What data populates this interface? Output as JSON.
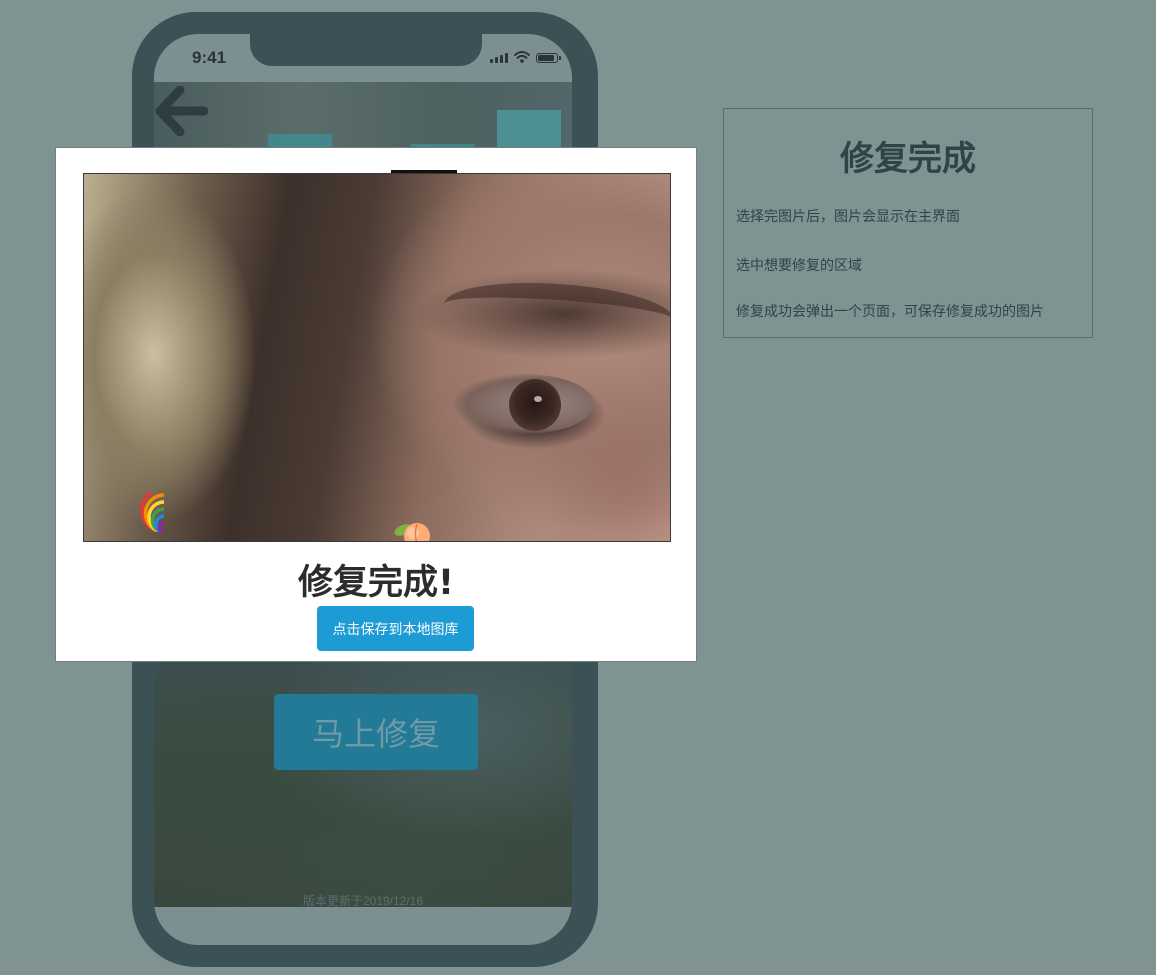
{
  "status_bar": {
    "time": "9:41"
  },
  "main_screen": {
    "repair_button": "马上修复",
    "version_text": "版本更新于2019/12/16"
  },
  "modal": {
    "title": "修复完成!",
    "save_button": "点击保存到本地图库"
  },
  "info_panel": {
    "title": "修复完成",
    "lines": [
      "选择完图片后，图片会显示在主界面",
      "选中想要修复的区域",
      "修复成功会弹出一个页面，可保存修复成功的图片"
    ]
  },
  "colors": {
    "background": "#7f9392",
    "phone_frame": "#3c5155",
    "save_button": "#1d9bd4",
    "repair_button": "#227a96"
  }
}
